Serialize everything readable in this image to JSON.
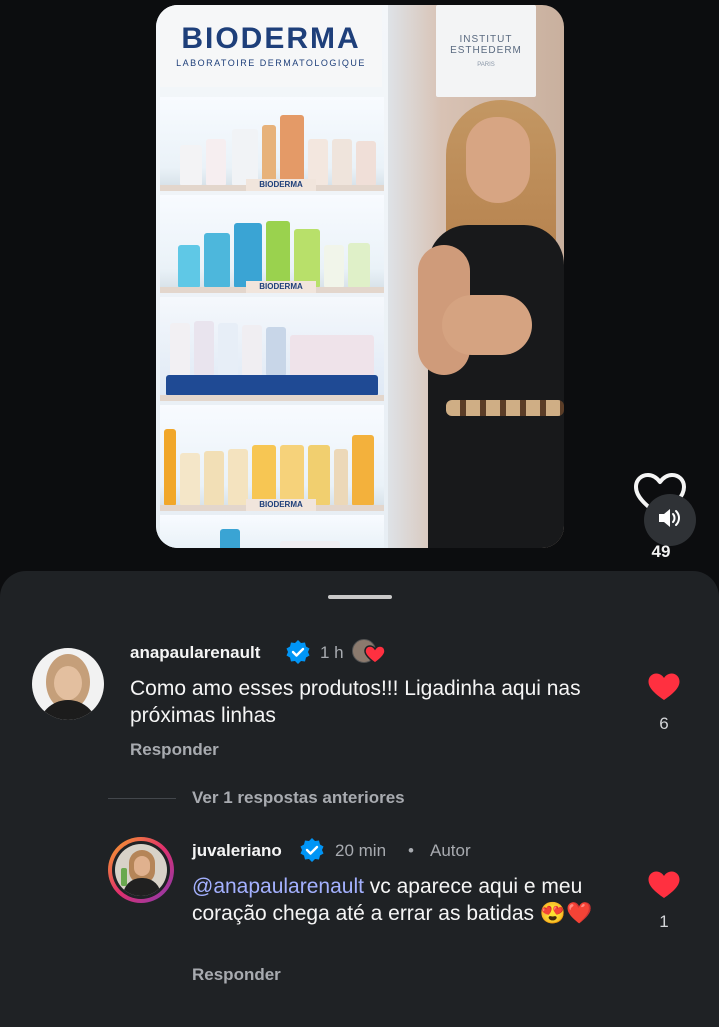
{
  "video": {
    "brand_left": "BIODERMA",
    "brand_left_sub": "LABORATOIRE DERMATOLOGIQUE",
    "brand_right": "INSTITUT",
    "brand_right_2": "ESTHEDERM",
    "brand_right_3": "PARIS",
    "shelf_label": "BIODERMA",
    "like_count": "49",
    "like_icon": "heart-outline-icon",
    "sound_icon": "speaker-icon"
  },
  "comments": [
    {
      "username": "anapaularenault",
      "time": "1 h",
      "text": "Como amo esses produtos!!! Ligadinha aqui nas próximas linhas",
      "reply_label": "Responder",
      "likes": "6",
      "liked_by_creator_icon": "creator-heart-icon"
    }
  ],
  "replies_toggle": "Ver 1 respostas anteriores",
  "reply": {
    "username": "juvaleriano",
    "time": "20 min",
    "separator": "•",
    "author_badge": "Autor",
    "mention": "@anapaularenault",
    "text": " vc aparece aqui e meu coração chega até a errar as batidas 😍❤️",
    "reply_label": "Responder",
    "likes": "1"
  },
  "colors": {
    "background": "#0c0d0f",
    "sheet": "#1f2225",
    "heart_red": "#ff3040",
    "verified_blue": "#0095f6",
    "mention": "#a4b1ff"
  }
}
